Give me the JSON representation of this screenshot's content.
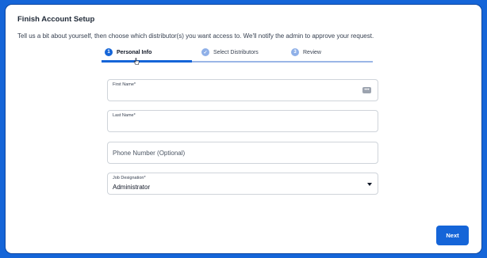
{
  "dialog": {
    "title": "Finish Account Setup",
    "description": "Tell us a bit about yourself, then choose which distributor(s) you want access to. We'll notify the admin to approve your request."
  },
  "steps": [
    {
      "number": "1",
      "label": "Personal Info",
      "state": "active"
    },
    {
      "number": "✓",
      "label": "Select Distributors",
      "state": "pending"
    },
    {
      "number": "3",
      "label": "Review",
      "state": "pending"
    }
  ],
  "form": {
    "first_name": {
      "label": "First Name*",
      "value": ""
    },
    "last_name": {
      "label": "Last Name*",
      "value": ""
    },
    "phone": {
      "placeholder": "Phone Number (Optional)"
    },
    "job_designation": {
      "label": "Job Designation*",
      "value": "Administrator"
    }
  },
  "actions": {
    "next_label": "Next"
  },
  "colors": {
    "accent": "#1565d8",
    "background": "#1565d8",
    "step_pending": "#8fb0e8"
  }
}
